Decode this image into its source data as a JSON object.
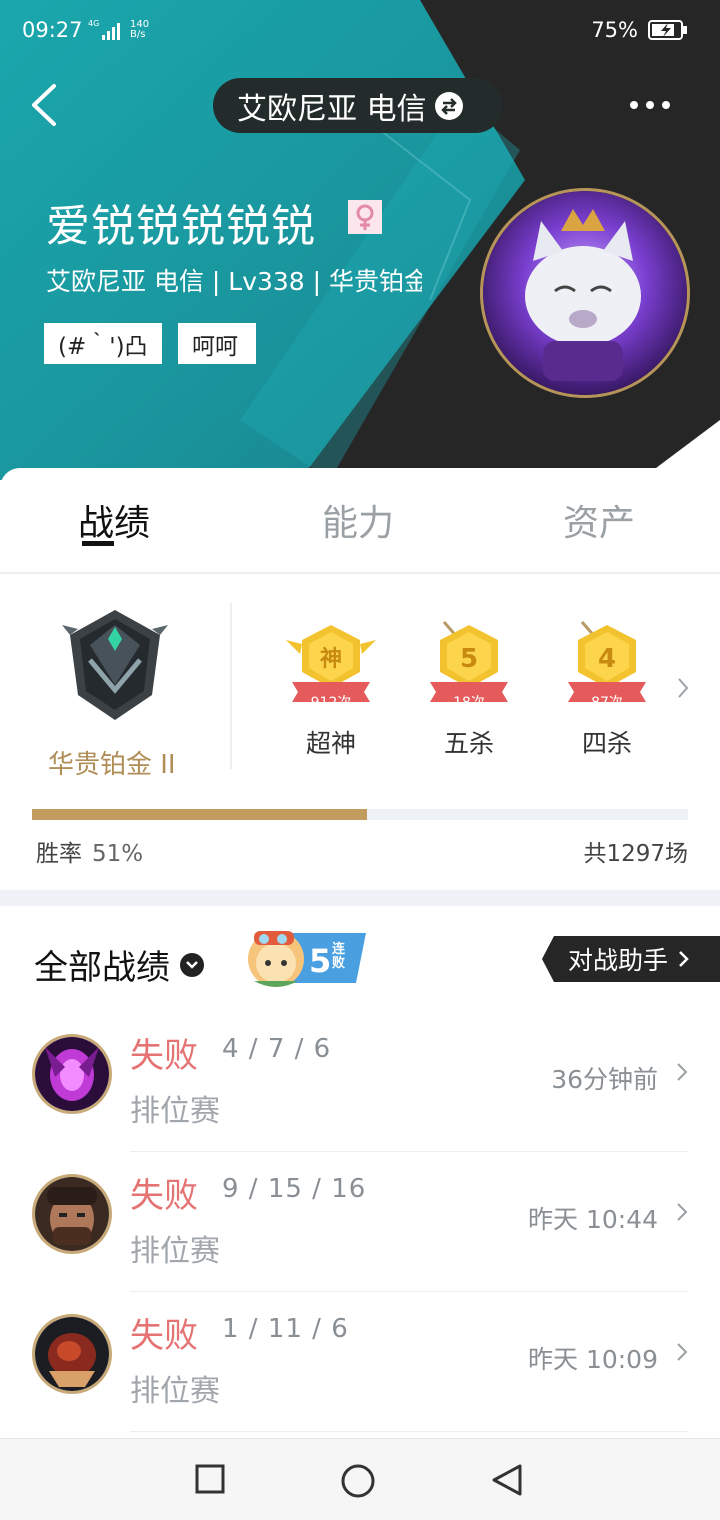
{
  "status_bar": {
    "time": "09:27",
    "network": "4G",
    "speed_value": "140",
    "speed_unit": "B/s",
    "battery": "75%"
  },
  "header": {
    "server": "艾欧尼亚 电信",
    "nickname": "爱锐锐锐锐锐",
    "subinfo": "艾欧尼亚 电信 | Lv338 | 华贵铂金 II",
    "tags": [
      "(#｀')凸",
      "呵呵"
    ],
    "colors": {
      "teal": "#1f9aa3",
      "dark": "#262626",
      "ring": "#b7955a"
    }
  },
  "tabs": [
    {
      "label": "战绩",
      "active": true
    },
    {
      "label": "能力",
      "active": false
    },
    {
      "label": "资产",
      "active": false
    }
  ],
  "rank": {
    "name": "华贵铂金 II"
  },
  "achievements": [
    {
      "glyph": "神",
      "count": "912次",
      "label": "超神"
    },
    {
      "glyph": "5",
      "count": "18次",
      "label": "五杀"
    },
    {
      "glyph": "4",
      "count": "87次",
      "label": "四杀"
    }
  ],
  "winrate": {
    "label": "胜率",
    "value": "51%",
    "fraction": 0.51,
    "total": "共1297场"
  },
  "records": {
    "title": "全部战绩",
    "streak": {
      "number": "5",
      "text": "连败"
    },
    "assistant": "对战助手"
  },
  "matches": [
    {
      "result": "失败",
      "kda": "4 / 7 / 6",
      "mode": "排位赛",
      "time": "36分钟前"
    },
    {
      "result": "失败",
      "kda": "9 / 15 / 16",
      "mode": "排位赛",
      "time": "昨天 10:44"
    },
    {
      "result": "失败",
      "kda": "1 / 11 / 6",
      "mode": "排位赛",
      "time": "昨天 10:09"
    }
  ]
}
